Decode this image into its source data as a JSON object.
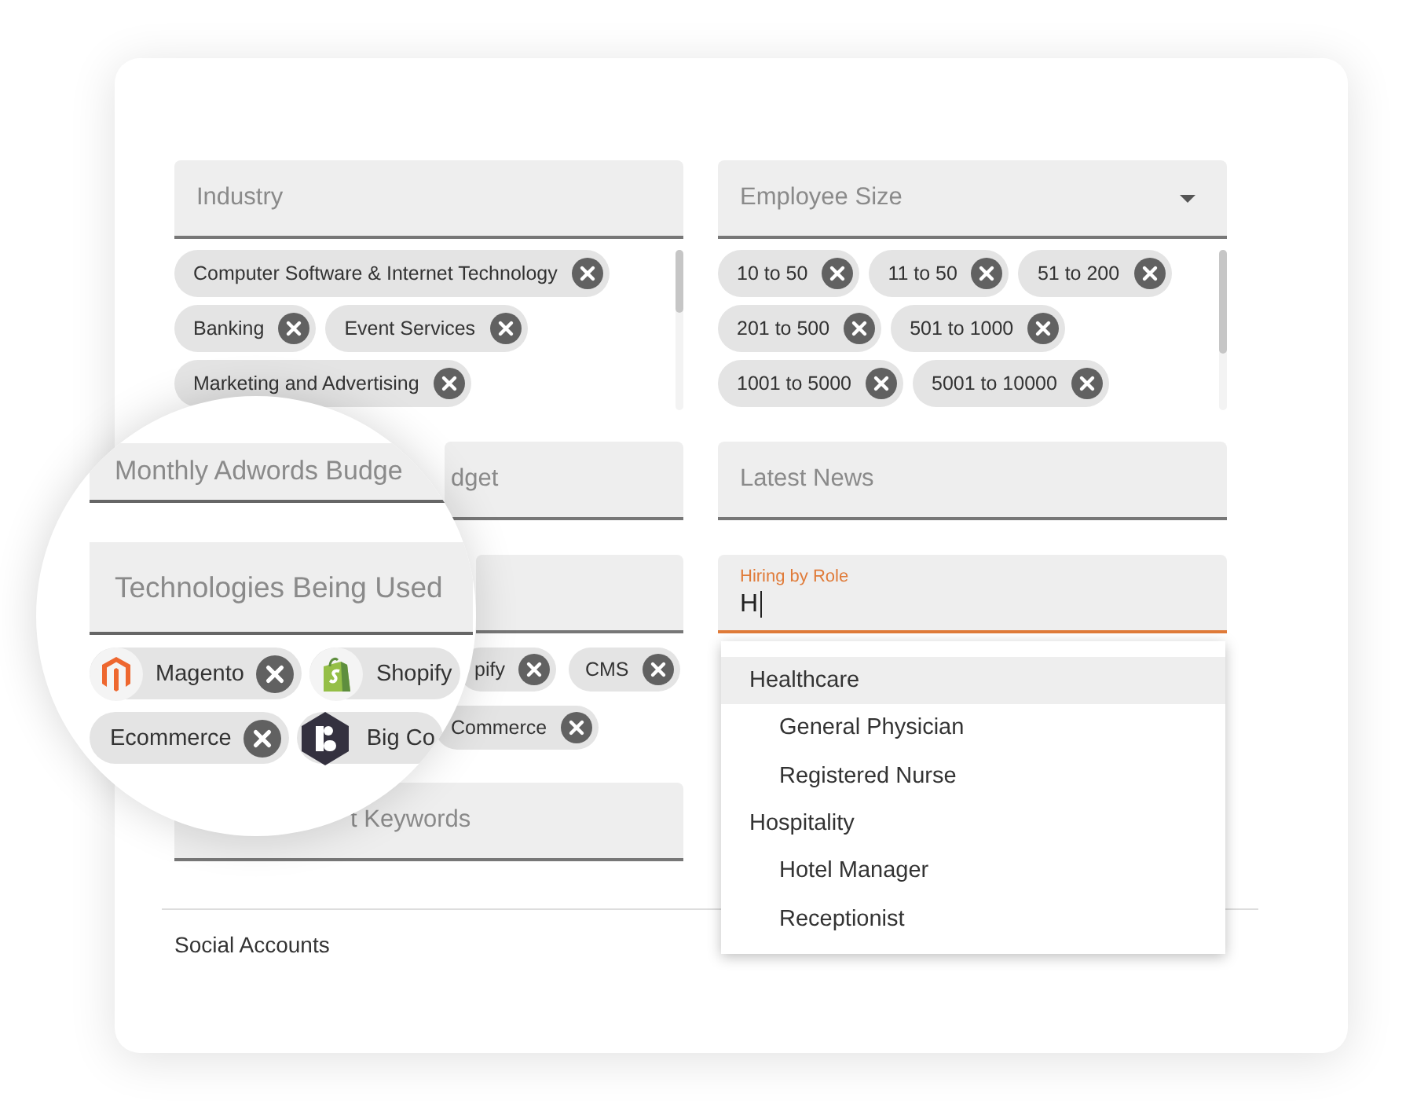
{
  "industry": {
    "label": "Industry",
    "chips": [
      {
        "label": "Computer Software & Internet Technology"
      },
      {
        "label": "Banking"
      },
      {
        "label": "Event Services"
      },
      {
        "label": "Marketing and Advertising"
      }
    ]
  },
  "employee_size": {
    "label": "Employee Size",
    "chips": [
      {
        "label": "10 to 50"
      },
      {
        "label": "11 to 50"
      },
      {
        "label": "51 to 200"
      },
      {
        "label": "201 to 500"
      },
      {
        "label": "501 to 1000"
      },
      {
        "label": "1001 to 5000"
      },
      {
        "label": "5001 to 10000"
      }
    ]
  },
  "monthly_budget": {
    "label": "dget"
  },
  "latest_news": {
    "label": "Latest News"
  },
  "technologies": {
    "chip_rows": [
      [
        {
          "label": "pify"
        },
        {
          "label": "CMS"
        }
      ],
      [
        {
          "label": "Commerce"
        }
      ]
    ]
  },
  "hiring_by_role": {
    "label": "Hiring by Role",
    "value": "H",
    "focused": true,
    "menu": [
      {
        "label": "Healthcare",
        "selected": true,
        "children": [
          {
            "label": "General Physician",
            "selected": false
          },
          {
            "label": "Registered Nurse",
            "selected": false
          }
        ]
      },
      {
        "label": "Hospitality",
        "selected": false,
        "children": [
          {
            "label": "Hotel Manager",
            "selected": false
          },
          {
            "label": "Receptionist",
            "selected": false
          }
        ]
      }
    ]
  },
  "keywords": {
    "label": "t Keywords"
  },
  "social_accounts": "Social Accounts",
  "magnifier": {
    "budget_label": "Monthly Adwords Budge",
    "technologies_label": "Technologies Being Used",
    "chip_rows": [
      [
        {
          "label": "Magento",
          "kind": "magento"
        },
        {
          "label": "Shopify",
          "kind": "shopify"
        }
      ],
      [
        {
          "label": "Ecommerce",
          "kind": "plain"
        },
        {
          "label": "Big Co",
          "kind": "bigcommerce"
        }
      ]
    ]
  }
}
